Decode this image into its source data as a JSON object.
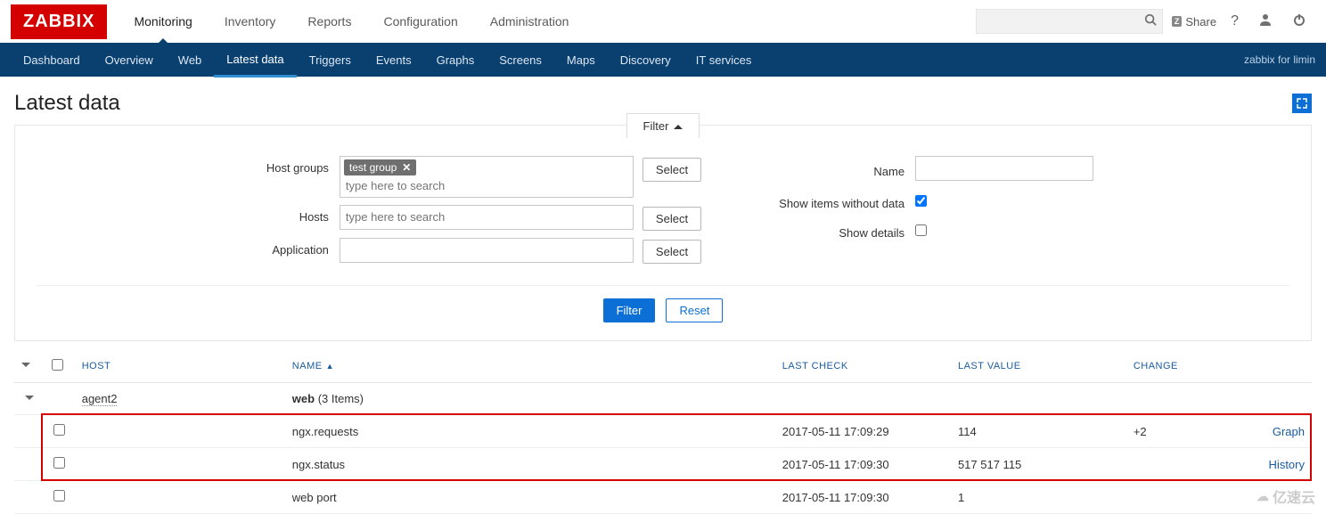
{
  "brand": "ZABBIX",
  "topnav": [
    "Monitoring",
    "Inventory",
    "Reports",
    "Configuration",
    "Administration"
  ],
  "topnav_active": "Monitoring",
  "share_label": "Share",
  "subnav": [
    "Dashboard",
    "Overview",
    "Web",
    "Latest data",
    "Triggers",
    "Events",
    "Graphs",
    "Screens",
    "Maps",
    "Discovery",
    "IT services"
  ],
  "subnav_active": "Latest data",
  "subnav_right": "zabbix for limin",
  "page_title": "Latest data",
  "filter": {
    "tab_label": "Filter",
    "host_groups_label": "Host groups",
    "host_groups_tag": "test group",
    "host_groups_placeholder": "type here to search",
    "hosts_label": "Hosts",
    "hosts_placeholder": "type here to search",
    "application_label": "Application",
    "select_btn": "Select",
    "name_label": "Name",
    "show_without_data_label": "Show items without data",
    "show_without_data_checked": true,
    "show_details_label": "Show details",
    "show_details_checked": false,
    "filter_btn": "Filter",
    "reset_btn": "Reset"
  },
  "table": {
    "headers": {
      "host": "Host",
      "name": "Name",
      "last_check": "Last check",
      "last_value": "Last value",
      "change": "Change"
    },
    "group": {
      "host": "agent2",
      "app": "web",
      "count_label": "(3 Items)"
    },
    "rows": [
      {
        "name": "ngx.requests",
        "last_check": "2017-05-11 17:09:29",
        "last_value": "114",
        "change": "+2",
        "action": "Graph"
      },
      {
        "name": "ngx.status",
        "last_check": "2017-05-11 17:09:30",
        "last_value": "517 517 115",
        "change": "",
        "action": "History"
      },
      {
        "name": "web port",
        "last_check": "2017-05-11 17:09:30",
        "last_value": "1",
        "change": "",
        "action": ""
      }
    ]
  },
  "watermark": "亿速云"
}
